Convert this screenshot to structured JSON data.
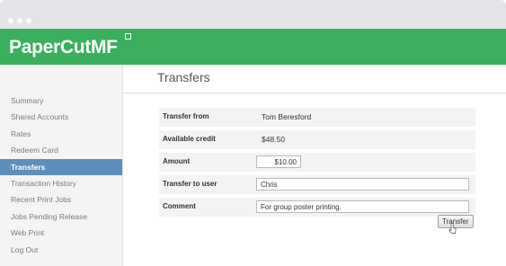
{
  "brand": {
    "name": "PaperCutMF"
  },
  "sidebar": {
    "items": [
      {
        "label": "Summary"
      },
      {
        "label": "Shared Accounts"
      },
      {
        "label": "Rates"
      },
      {
        "label": "Redeem Card"
      },
      {
        "label": "Transfers",
        "active": true
      },
      {
        "label": "Transaction History"
      },
      {
        "label": "Recent Print Jobs"
      },
      {
        "label": "Jobs Pending Release"
      },
      {
        "label": "Web Print"
      },
      {
        "label": "Log Out"
      }
    ]
  },
  "main": {
    "title": "Transfers",
    "form": {
      "transfer_from_label": "Transfer from",
      "transfer_from_value": "Tom Beresford",
      "available_credit_label": "Available credit",
      "available_credit_value": "$48.50",
      "amount_label": "Amount",
      "amount_value": "$10.00",
      "transfer_to_label": "Transfer to user",
      "transfer_to_value": "Chris",
      "comment_label": "Comment",
      "comment_value": "For group poster printing.",
      "submit_label": "Transfer"
    }
  },
  "colors": {
    "brand_green": "#3aaf5c",
    "active_item": "#5d8fbd",
    "titlebar": "#e4e5e8"
  }
}
